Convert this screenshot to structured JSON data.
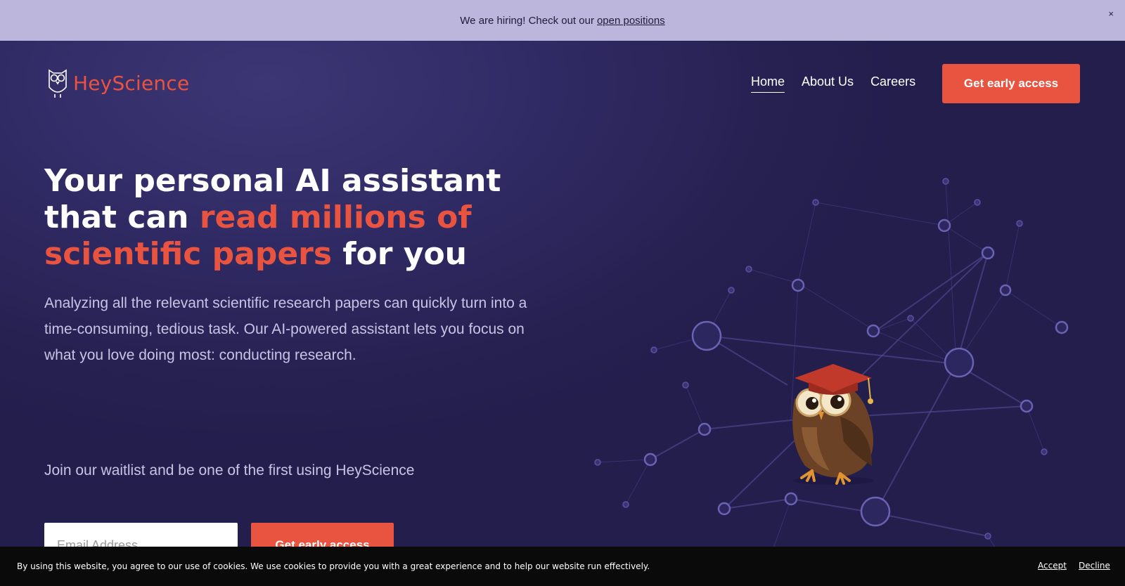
{
  "announcement": {
    "text": "We are hiring! Check out our",
    "link_label": "open positions",
    "close_label": "×"
  },
  "header": {
    "brand": "HeyScience",
    "nav": [
      {
        "label": "Home",
        "active": true
      },
      {
        "label": "About Us",
        "active": false
      },
      {
        "label": "Careers",
        "active": false
      }
    ],
    "cta_label": "Get early access"
  },
  "hero": {
    "headline_part1": "Your personal AI assistant that can ",
    "headline_highlight": "read millions of scientific papers",
    "headline_part2": " for you",
    "lead": "Analyzing all the relevant scientific research papers can quickly turn into a time-consuming, tedious task. Our AI-powered assistant lets you focus on what you love doing most: conducting research.",
    "waitlist_text": "Join our waitlist and be one of the first using HeyScience",
    "email_placeholder": "Email Address",
    "form_cta_label": "Get early access"
  },
  "cookie_bar": {
    "message": "By using this website, you agree to our use of cookies. We use cookies to provide you with a great experience and to help our website run effectively.",
    "accept_label": "Accept",
    "decline_label": "Decline"
  },
  "colors": {
    "accent": "#e8543f",
    "background": "#2a2557",
    "announcement_bg": "#bdb6dc"
  }
}
